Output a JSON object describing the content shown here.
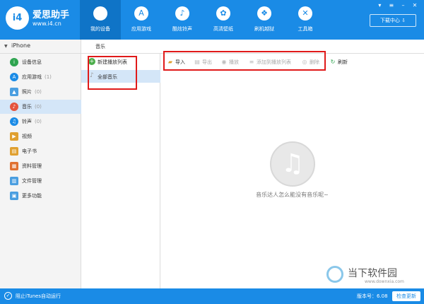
{
  "app": {
    "logo_badge": "i4",
    "name": "爱思助手",
    "url": "www.i4.cn"
  },
  "nav": {
    "items": [
      {
        "label": "我的设备",
        "icon": "apple-icon",
        "active": true
      },
      {
        "label": "应用游戏",
        "icon": "app-store-icon",
        "active": false
      },
      {
        "label": "酷炫铃声",
        "icon": "bell-icon",
        "active": false
      },
      {
        "label": "高清壁纸",
        "icon": "flower-icon",
        "active": false
      },
      {
        "label": "刷机越狱",
        "icon": "dropbox-icon",
        "active": false
      },
      {
        "label": "工具箱",
        "icon": "tools-icon",
        "active": false
      }
    ]
  },
  "header_right": {
    "download_center": "下载中心"
  },
  "sidebar": {
    "device": "iPhone",
    "items": [
      {
        "label": "设备信息",
        "count": "",
        "icon": "info-icon",
        "color": "#2ea44f"
      },
      {
        "label": "应用游戏",
        "count": "(1)",
        "icon": "apps-icon",
        "color": "#1a8be6"
      },
      {
        "label": "照片",
        "count": "(0)",
        "icon": "photo-icon",
        "color": "#4a9ee0"
      },
      {
        "label": "音乐",
        "count": "(0)",
        "icon": "music-icon",
        "color": "#e5533d",
        "active": true
      },
      {
        "label": "铃声",
        "count": "(0)",
        "icon": "ringtone-icon",
        "color": "#1a8be6"
      },
      {
        "label": "视频",
        "count": "",
        "icon": "video-icon",
        "color": "#e0a030"
      },
      {
        "label": "电子书",
        "count": "",
        "icon": "book-icon",
        "color": "#e0a030"
      },
      {
        "label": "资料管理",
        "count": "",
        "icon": "contacts-icon",
        "color": "#e07030"
      },
      {
        "label": "文件管理",
        "count": "",
        "icon": "file-icon",
        "color": "#4a9ee0"
      },
      {
        "label": "更多功能",
        "count": "",
        "icon": "more-icon",
        "color": "#4a9ee0"
      }
    ]
  },
  "music": {
    "tab": "音乐",
    "new_playlist": "新建播放列表",
    "all_music": "全部音乐",
    "toolbar": {
      "import": "导入",
      "export": "导出",
      "play": "播放",
      "add_to_playlist": "添加到播放列表",
      "delete": "删除",
      "refresh": "刷新"
    },
    "empty_text": "音乐达人怎么能没有音乐呢~"
  },
  "watermark": {
    "name": "当下软件园",
    "url": "www.downxia.com"
  },
  "statusbar": {
    "itunes_label": "阻止iTunes自动运行",
    "version": "版本号：6.08",
    "update": "检查更新"
  }
}
